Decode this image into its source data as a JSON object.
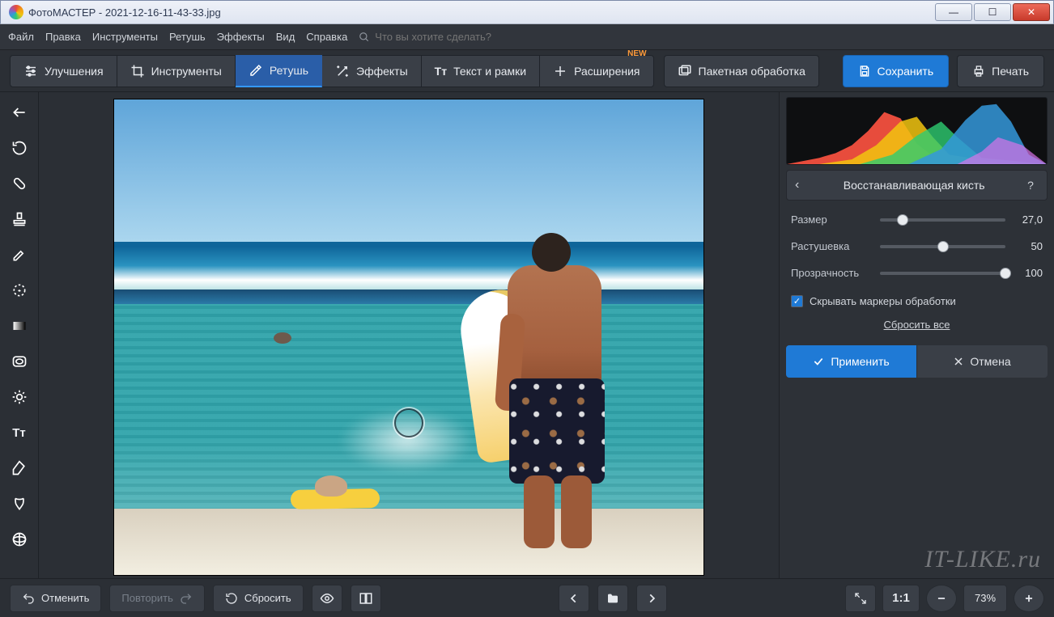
{
  "window": {
    "title": "ФотоМАСТЕР - 2021-12-16-11-43-33.jpg"
  },
  "menubar": {
    "items": [
      "Файл",
      "Правка",
      "Инструменты",
      "Ретушь",
      "Эффекты",
      "Вид",
      "Справка"
    ],
    "search_placeholder": "Что вы хотите сделать?"
  },
  "toolbar": {
    "tabs": [
      {
        "label": "Улучшения"
      },
      {
        "label": "Инструменты"
      },
      {
        "label": "Ретушь",
        "active": true
      },
      {
        "label": "Эффекты"
      },
      {
        "label": "Текст и рамки"
      },
      {
        "label": "Расширения",
        "badge": "NEW"
      }
    ],
    "batch_label": "Пакетная обработка",
    "save_label": "Сохранить",
    "print_label": "Печать"
  },
  "panel": {
    "title": "Восстанавливающая кисть",
    "sliders": [
      {
        "label": "Размер",
        "value": "27,0",
        "pct": 18
      },
      {
        "label": "Растушевка",
        "value": "50",
        "pct": 50
      },
      {
        "label": "Прозрачность",
        "value": "100",
        "pct": 100
      }
    ],
    "hide_markers_label": "Скрывать маркеры обработки",
    "hide_markers_checked": true,
    "reset_label": "Сбросить все",
    "apply_label": "Применить",
    "cancel_label": "Отмена"
  },
  "bottombar": {
    "undo_label": "Отменить",
    "redo_label": "Повторить",
    "reset_label": "Сбросить",
    "one_to_one": "1:1",
    "zoom_pct": "73%"
  },
  "watermark": "IT-LIKE.ru"
}
